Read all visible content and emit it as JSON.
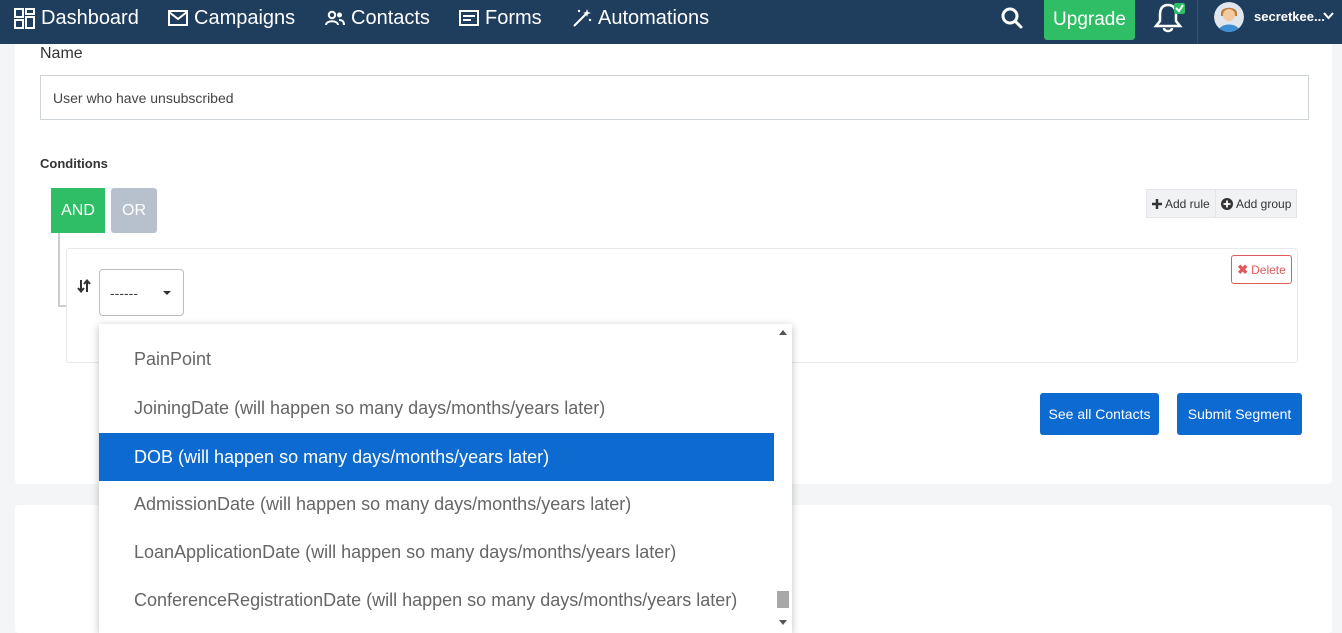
{
  "nav": {
    "items": [
      {
        "label": "Dashboard",
        "icon": "dashboard-icon"
      },
      {
        "label": "Campaigns",
        "icon": "envelope-icon"
      },
      {
        "label": "Contacts",
        "icon": "users-icon"
      },
      {
        "label": "Forms",
        "icon": "form-icon"
      },
      {
        "label": "Automations",
        "icon": "magic-wand-icon"
      }
    ],
    "upgrade_label": "Upgrade",
    "username": "secretkee...",
    "colors": {
      "bar": "#1f3d5c",
      "upgrade": "#2fbe66"
    }
  },
  "form": {
    "name_label": "Name",
    "name_value": "User who have unsubscribed",
    "conditions_label": "Conditions",
    "and_label": "AND",
    "or_label": "OR",
    "add_rule_label": "Add rule",
    "add_group_label": "Add group",
    "field_select_value": "------",
    "delete_label": "Delete",
    "see_all_label": "See all Contacts",
    "submit_label": "Submit Segment"
  },
  "dropdown": {
    "selected_index": 2,
    "options": [
      "PainPoint",
      "JoiningDate (will happen so many days/months/years later)",
      "DOB (will happen so many days/months/years later)",
      "AdmissionDate (will happen so many days/months/years later)",
      "LoanApplicationDate (will happen so many days/months/years later)",
      "ConferenceRegistrationDate (will happen so many days/months/years later)"
    ],
    "colors": {
      "selected": "#0d6ad0"
    }
  }
}
